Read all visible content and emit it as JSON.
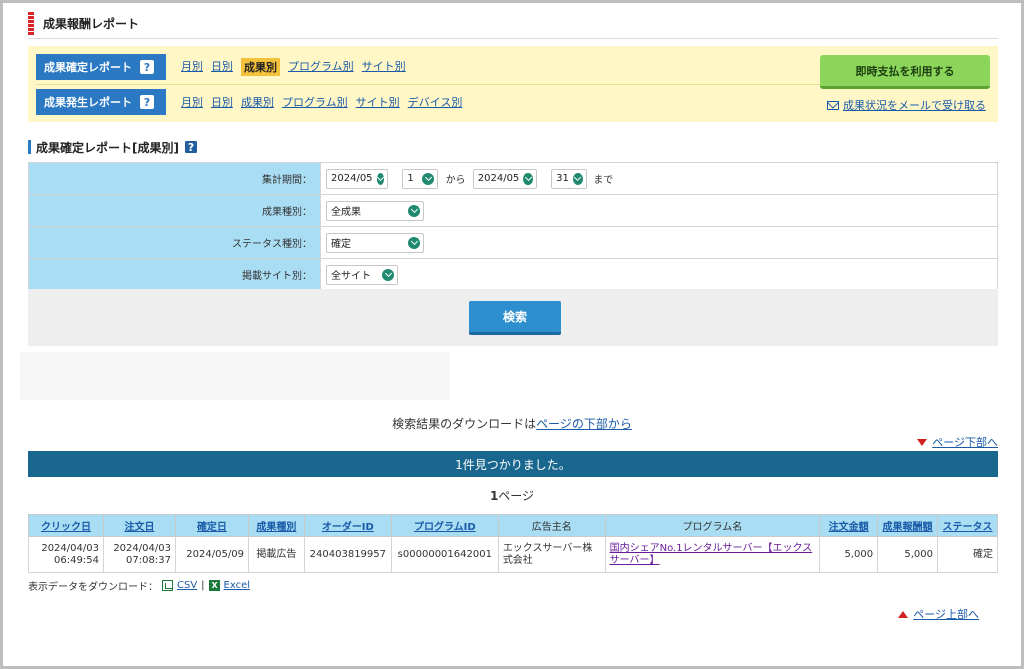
{
  "header": {
    "title": "成果報酬レポート"
  },
  "nav": {
    "confirmed": {
      "badge": "成果確定レポート",
      "links": [
        "月別",
        "日別",
        "成果別",
        "プログラム別",
        "サイト別"
      ],
      "active_index": 2
    },
    "occurred": {
      "badge": "成果発生レポート",
      "links": [
        "月別",
        "日別",
        "成果別",
        "プログラム別",
        "サイト別",
        "デバイス別"
      ]
    },
    "help_glyph": "?",
    "instant_pay_label": "即時支払を利用する",
    "mail_link_label": "成果状況をメールで受け取る"
  },
  "section": {
    "title": "成果確定レポート[成果別]"
  },
  "form": {
    "period": {
      "label": "集計期間：",
      "start_month": "2024/05",
      "start_day": "1",
      "from_text": "から",
      "end_month": "2024/05",
      "end_day": "31",
      "until_text": "まで"
    },
    "reward_type": {
      "label": "成果種別：",
      "value": "全成果"
    },
    "status_type": {
      "label": "ステータス種別：",
      "value": "確定"
    },
    "site": {
      "label": "掲載サイト別：",
      "value": "全サイト"
    },
    "search_label": "検索"
  },
  "download_note": {
    "text": "検索結果のダウンロードは",
    "link": "ページの下部から"
  },
  "to_bottom_label": "ページ下部へ",
  "result": {
    "count_text": "1件見つかりました。",
    "page_num": "1",
    "page_suffix": "ページ"
  },
  "table": {
    "headers": [
      "クリック日",
      "注文日",
      "確定日",
      "成果種別",
      "オーダーID",
      "プログラムID",
      "広告主名",
      "プログラム名",
      "注文金額",
      "成果報酬額",
      "ステータス"
    ],
    "rows": [
      {
        "click_date": "2024/04/03",
        "click_time": "06:49:54",
        "order_date": "2024/04/03",
        "order_time": "07:08:37",
        "confirm_date": "2024/05/09",
        "type": "掲載広告",
        "order_id": "240403819957",
        "program_id": "s00000001642001",
        "advertiser": "エックスサーバー株式会社",
        "program_name": "国内シェアNo.1レンタルサーバー【エックスサーバー】",
        "amount": "5,000",
        "reward": "5,000",
        "status": "確定"
      }
    ]
  },
  "download_row": {
    "label": "表示データをダウンロード：",
    "csv": "CSV",
    "sep": "|",
    "excel": "Excel"
  },
  "to_top_label": "ページ上部へ",
  "colors": {
    "accent_blue": "#2b78c3",
    "header_cell": "#a9ddf4",
    "nav_bg": "#fff8c6",
    "result_bar": "#19668f",
    "pay_button": "#8bd65a"
  }
}
